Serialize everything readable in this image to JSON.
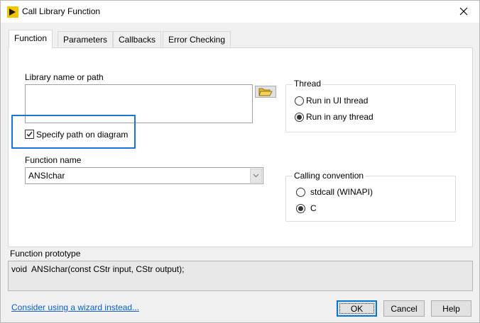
{
  "window": {
    "title": "Call Library Function"
  },
  "tabs": [
    {
      "label": "Function",
      "active": true
    },
    {
      "label": "Parameters",
      "active": false
    },
    {
      "label": "Callbacks",
      "active": false
    },
    {
      "label": "Error Checking",
      "active": false
    }
  ],
  "function_tab": {
    "library_label": "Library name or path",
    "library_value": "",
    "specify_path_label": "Specify path on diagram",
    "specify_path_checked": true,
    "function_name_label": "Function name",
    "function_name_value": "ANSIchar",
    "thread": {
      "title": "Thread",
      "options": [
        "Run in UI thread",
        "Run in any thread"
      ],
      "selected": "Run in any thread"
    },
    "calling_convention": {
      "title": "Calling convention",
      "options": [
        "stdcall (WINAPI)",
        "C"
      ],
      "selected": "C"
    }
  },
  "prototype": {
    "label": "Function prototype",
    "text": "void  ANSIchar(const CStr input, CStr output);"
  },
  "footer": {
    "wizard_link": "Consider using a wizard instead...",
    "ok_label": "OK",
    "cancel_label": "Cancel",
    "help_label": "Help"
  },
  "colors": {
    "highlight": "#1a73d9",
    "link": "#0b5fd0",
    "default_button_border": "#0078d7"
  }
}
